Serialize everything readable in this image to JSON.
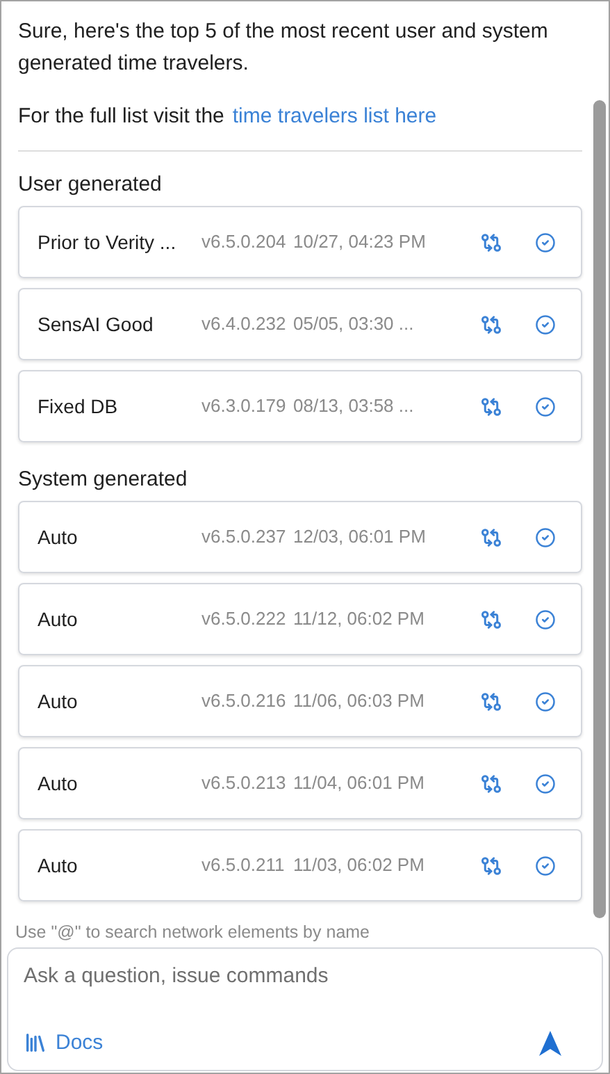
{
  "message": {
    "intro": "Sure, here's the top 5 of the most recent user and system generated time travelers.",
    "link_prefix": "For the full list visit the",
    "link": "time travelers list here"
  },
  "groups": [
    {
      "title": "User generated",
      "items": [
        {
          "name": "Prior to Verity ...",
          "version": "v6.5.0.204",
          "time": "10/27, 04:23 PM"
        },
        {
          "name": "SensAI Good",
          "version": "v6.4.0.232",
          "time": "05/05, 03:30 ..."
        },
        {
          "name": "Fixed DB",
          "version": "v6.3.0.179",
          "time": "08/13, 03:58 ..."
        }
      ]
    },
    {
      "title": "System generated",
      "items": [
        {
          "name": "Auto",
          "version": "v6.5.0.237",
          "time": "12/03, 06:01 PM"
        },
        {
          "name": "Auto",
          "version": "v6.5.0.222",
          "time": "11/12, 06:02 PM"
        },
        {
          "name": "Auto",
          "version": "v6.5.0.216",
          "time": "11/06, 06:03 PM"
        },
        {
          "name": "Auto",
          "version": "v6.5.0.213",
          "time": "11/04, 06:01 PM"
        },
        {
          "name": "Auto",
          "version": "v6.5.0.211",
          "time": "11/03, 06:02 PM"
        }
      ]
    }
  ],
  "hint": "Use \"@\" to search network elements by name",
  "composer": {
    "placeholder": "Ask a question, issue commands",
    "docs": "Docs"
  }
}
